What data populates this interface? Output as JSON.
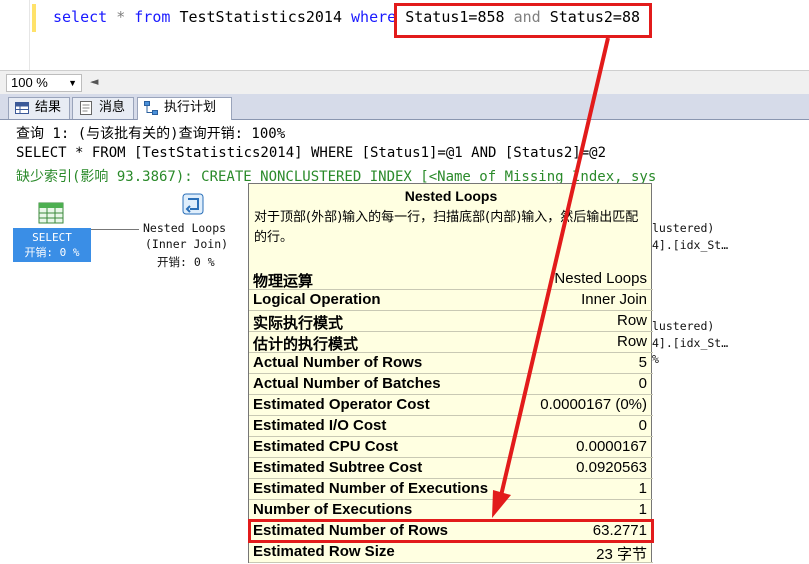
{
  "editor": {
    "kw_select": "select",
    "star": "*",
    "kw_from": "from",
    "table": "TestStatistics2014",
    "kw_where": "where",
    "cond1": "Status1=858",
    "kw_and": "and",
    "cond2": "Status2=88"
  },
  "zoom": {
    "value": "100 %"
  },
  "tabs": [
    {
      "label": "结果",
      "icon": "grid-icon"
    },
    {
      "label": "消息",
      "icon": "message-icon"
    },
    {
      "label": "执行计划",
      "icon": "plan-icon"
    }
  ],
  "query": {
    "line1": "查询 1: (与该批有关的)查询开销: 100%",
    "line2": "SELECT * FROM [TestStatistics2014] WHERE [Status1]=@1 AND [Status2]=@2",
    "missing_index": "缺少索引(影响 93.3867): CREATE NONCLUSTERED INDEX [<Name of Missing Index, sys"
  },
  "plan": {
    "select_node": {
      "label": "SELECT",
      "cost": "开销: 0 %"
    },
    "nested_node": {
      "line1": "Nested Loops",
      "line2": "(Inner Join)",
      "cost": "开销: 0 %"
    },
    "right_frag1": {
      "line1": "lustered)",
      "line2": "4].[idx_St…"
    },
    "right_frag2": {
      "line1": "lustered)",
      "line2": "4].[idx_St…",
      "line3": "%"
    }
  },
  "tooltip": {
    "title": "Nested Loops",
    "description": "对于顶部(外部)输入的每一行，扫描底部(内部)输入，然后输出匹配的行。",
    "rows": [
      {
        "key": "物理运算",
        "value": "Nested Loops"
      },
      {
        "key": "Logical Operation",
        "value": "Inner Join"
      },
      {
        "key": "实际执行模式",
        "value": "Row"
      },
      {
        "key": "估计的执行模式",
        "value": "Row"
      },
      {
        "key": "Actual Number of Rows",
        "value": "5"
      },
      {
        "key": "Actual Number of Batches",
        "value": "0"
      },
      {
        "key": "Estimated Operator Cost",
        "value": "0.0000167 (0%)"
      },
      {
        "key": "Estimated I/O Cost",
        "value": "0"
      },
      {
        "key": "Estimated CPU Cost",
        "value": "0.0000167"
      },
      {
        "key": "Estimated Subtree Cost",
        "value": "0.0920563"
      },
      {
        "key": "Estimated Number of Executions",
        "value": "1"
      },
      {
        "key": "Number of Executions",
        "value": "1"
      },
      {
        "key": "Estimated Number of Rows",
        "value": "63.2771"
      },
      {
        "key": "Estimated Row Size",
        "value": "23 字节"
      }
    ]
  },
  "colors": {
    "highlight": "#e21b1b",
    "tooltip_bg": "#ffffe1",
    "keyword": "#1a1aff",
    "select_node": "#3a8ee6"
  }
}
